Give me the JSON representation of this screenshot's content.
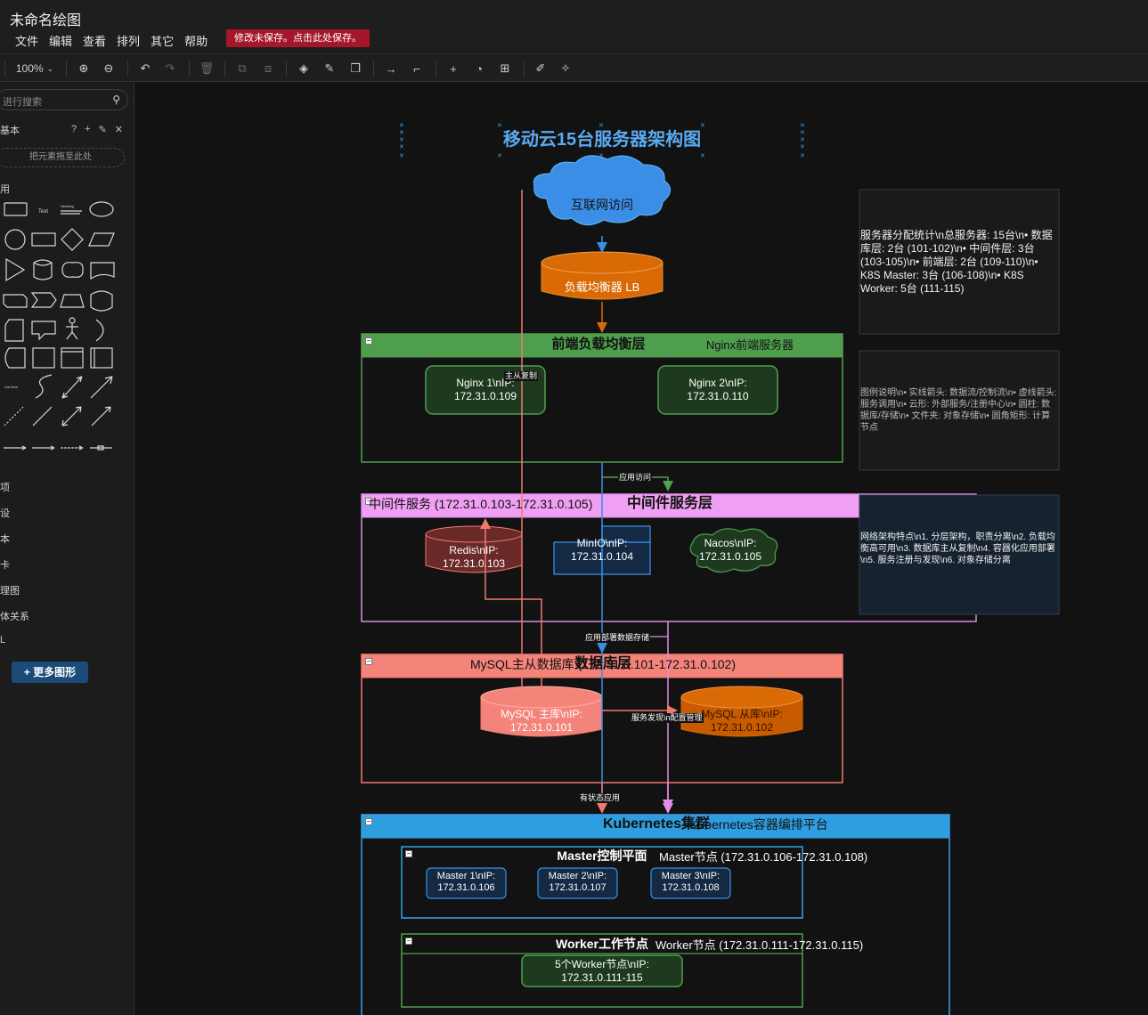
{
  "app": {
    "title": "未命名绘图",
    "menu": [
      "文件",
      "编辑",
      "查看",
      "排列",
      "其它",
      "帮助"
    ],
    "unsaved_banner": "修改未保存。点击此处保存。"
  },
  "toolbar": {
    "zoom": "100%"
  },
  "sidebar": {
    "search_placeholder": "进行搜索",
    "scratchpad_title": "基本",
    "drop_zone": "把元素拖至此处",
    "general_label": "用",
    "categories": [
      "项",
      "设",
      "本",
      "卡",
      "理图",
      "体关系",
      "L"
    ],
    "more_shapes": "+ 更多图形",
    "shape_texts": {
      "text": "Text",
      "heading": "Heading",
      "list": "List Item"
    }
  },
  "diagram": {
    "title": "移动云15台服务器架构图",
    "internet": "互联网访问",
    "lb": "负载均衡器 LB",
    "frontend": {
      "title": "前端负载均衡层",
      "subtitle": "Nginx前端服务器",
      "nginx1": [
        "Nginx 1\\nIP:",
        "172.31.0.109"
      ],
      "nginx2": [
        "Nginx 2\\nIP:",
        "172.31.0.110"
      ]
    },
    "middleware": {
      "title": "中间件服务层",
      "subtitle": "中间件服务 (172.31.0.103-172.31.0.105)",
      "redis": [
        "Redis\\nIP:",
        "172.31.0.103"
      ],
      "minio": [
        "MinIO\\nIP:",
        "172.31.0.104"
      ],
      "nacos": [
        "Nacos\\nIP:",
        "172.31.0.105"
      ]
    },
    "database": {
      "title": "数据库层",
      "subtitle": "MySQL主从数据库 (172.31.0.101-172.31.0.102)",
      "master": [
        "MySQL 主库\\nIP:",
        "172.31.0.101"
      ],
      "slave": [
        "MySQL 从库\\nIP:",
        "172.31.0.102"
      ]
    },
    "k8s": {
      "title": "Kubernetes集群",
      "subtitle": "Kubernetes容器编排平台",
      "master_plane": {
        "title": "Master控制平面",
        "subtitle": "Master节点 (172.31.0.106-172.31.0.108)",
        "nodes": [
          [
            "Master 1\\nIP:",
            "172.31.0.106"
          ],
          [
            "Master 2\\nIP:",
            "172.31.0.107"
          ],
          [
            "Master 3\\nIP:",
            "172.31.0.108"
          ]
        ]
      },
      "worker": {
        "title": "Worker工作节点",
        "subtitle": "Worker节点 (172.31.0.111-172.31.0.115)",
        "node": [
          "5个Worker节点\\nIP:",
          "172.31.0.111-115"
        ]
      }
    },
    "edges": {
      "replication": "主从复制",
      "app_access": "应用访问",
      "deploy_storage": "应用部署数据存储",
      "service_discovery": "服务发现\\n配置管理",
      "stateful_app": "有状态应用"
    },
    "notes": {
      "stats": "服务器分配统计\\n总服务器: 15台\\n• 数据库层: 2台 (101-102)\\n• 中间件层: 3台 (103-105)\\n• 前端层: 2台 (109-110)\\n• K8S Master: 3台 (106-108)\\n• K8S Worker: 5台 (111-115)",
      "legend": "图例说明\\n• 实线箭头: 数据流/控制流\\n• 虚线箭头: 服务调用\\n• 云形: 外部服务/注册中心\\n• 圆柱: 数据库/存储\\n• 文件夹: 对象存储\\n• 圆角矩形: 计算节点",
      "features": "网络架构特点\\n1. 分层架构，职责分离\\n2. 负载均衡高可用\\n3. 数据库主从复制\\n4. 容器化应用部署\\n5. 服务注册与发现\\n6. 对象存储分离"
    }
  }
}
